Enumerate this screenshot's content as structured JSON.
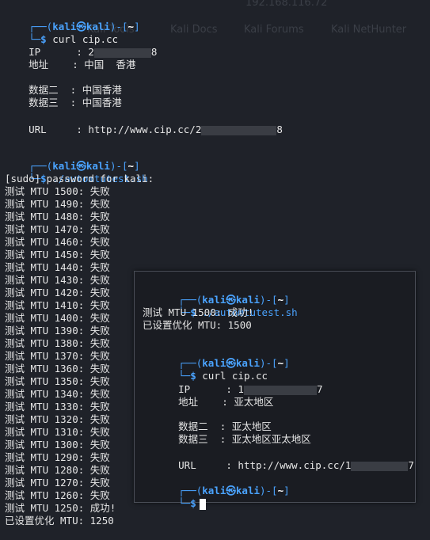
{
  "ghost": {
    "ip": "192.168.116.72",
    "bookmarks": [
      "Kali Tools",
      "Kali Docs",
      "Kali Forums",
      "Kali NetHunter"
    ]
  },
  "prompt": {
    "bracket_open": "┌──(",
    "user": "kali",
    "at": "㉿",
    "host": "kali",
    "bracket_mid": ")-[",
    "dir": "~",
    "bracket_close": "]",
    "arrow": "└─",
    "dollar": "$"
  },
  "main": {
    "cmd1": "curl cip.cc",
    "curl1": {
      "ip_label": "IP      : ",
      "ip_prefix": "2",
      "ip_suffix": "8",
      "addr_label": "地址    : ",
      "addr_value": "中国  香港",
      "d2_label": "数据二  : ",
      "d2_value": "中国香港",
      "d3_label": "数据三  : ",
      "d3_value": "中国香港",
      "url_label": "URL     : ",
      "url_value": "http://www.cip.cc/2",
      "url_suffix": "8"
    },
    "cmd2": "./automtutest.sh",
    "sudo": "[sudo] password for kali:",
    "mtu_lines": [
      "测试 MTU 1500: 失败",
      "测试 MTU 1490: 失败",
      "测试 MTU 1480: 失败",
      "测试 MTU 1470: 失败",
      "测试 MTU 1460: 失败",
      "测试 MTU 1450: 失败",
      "测试 MTU 1440: 失败",
      "测试 MTU 1430: 失败",
      "测试 MTU 1420: 失败",
      "测试 MTU 1410: 失败",
      "测试 MTU 1400: 失败",
      "测试 MTU 1390: 失败",
      "测试 MTU 1380: 失败",
      "测试 MTU 1370: 失败",
      "测试 MTU 1360: 失败",
      "测试 MTU 1350: 失败",
      "测试 MTU 1340: 失败",
      "测试 MTU 1330: 失败",
      "测试 MTU 1320: 失败",
      "测试 MTU 1310: 失败",
      "测试 MTU 1300: 失败",
      "测试 MTU 1290: 失败",
      "测试 MTU 1280: 失败",
      "测试 MTU 1270: 失败",
      "测试 MTU 1260: 失败",
      "测试 MTU 1250: 成功!"
    ],
    "result": "已设置优化 MTU: 1250"
  },
  "overlay": {
    "cmd1": "./automtutest.sh",
    "test_line": "测试 MTU 1500: 成功!",
    "result": "已设置优化 MTU: 1500",
    "cmd2": "curl cip.cc",
    "curl": {
      "ip_label": "IP      : ",
      "ip_prefix": "1",
      "ip_suffix": "7",
      "addr_label": "地址    : ",
      "addr_value": "亚太地区",
      "d2_label": "数据二  : ",
      "d2_value": "亚太地区",
      "d3_label": "数据三  : ",
      "d3_value": "亚太地区亚太地区",
      "url_label": "URL     : ",
      "url_value": "http://www.cip.cc/1",
      "url_suffix": "7"
    }
  },
  "colors": {
    "prompt_blue": "#4aa3ff",
    "background": "#1f2229",
    "panel": "#1a1c22"
  }
}
